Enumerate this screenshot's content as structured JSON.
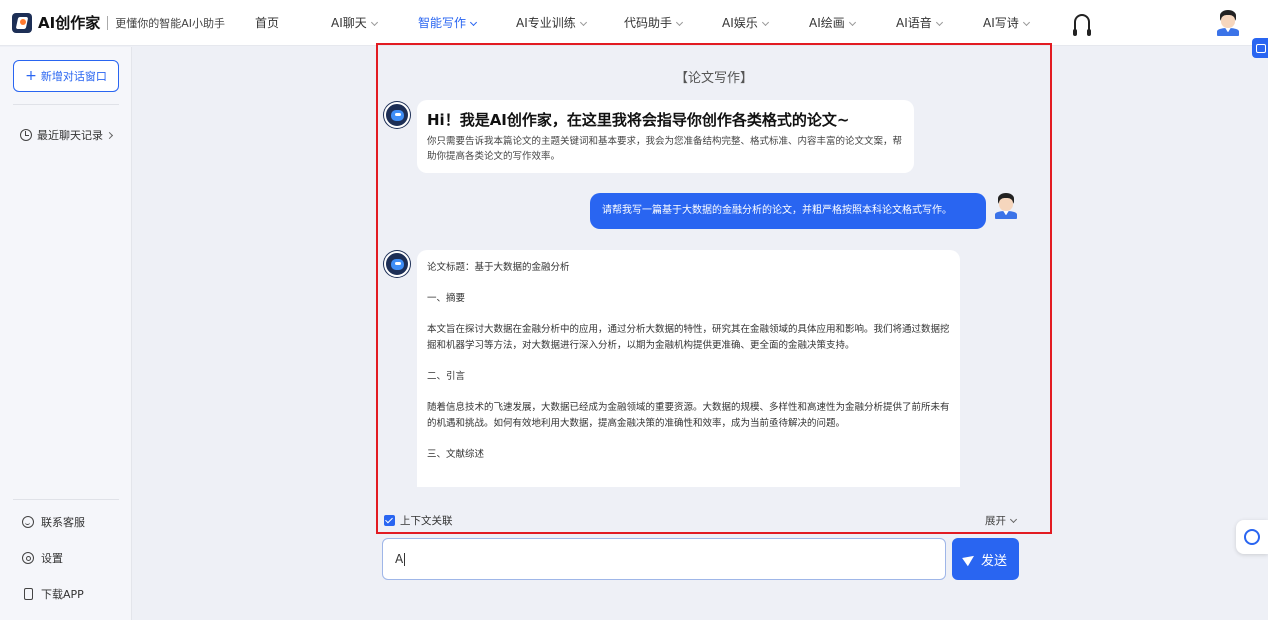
{
  "header": {
    "brand": "AI创作家",
    "tagline": "更懂你的智能AI小助手",
    "nav": [
      {
        "label": "首页",
        "dropdown": false
      },
      {
        "label": "AI聊天",
        "dropdown": true
      },
      {
        "label": "智能写作",
        "dropdown": true,
        "active": true
      },
      {
        "label": "AI专业训练",
        "dropdown": true
      },
      {
        "label": "代码助手",
        "dropdown": true
      },
      {
        "label": "AI娱乐",
        "dropdown": true
      },
      {
        "label": "AI绘画",
        "dropdown": true
      },
      {
        "label": "AI语音",
        "dropdown": true
      },
      {
        "label": "AI写诗",
        "dropdown": true
      }
    ],
    "icons": {
      "support": "headset-icon",
      "profile": "avatar"
    }
  },
  "sidebar": {
    "new_chat": "新增对话窗口",
    "recent": "最近聊天记录",
    "links": [
      {
        "label": "联系客服",
        "icon": "smile-icon"
      },
      {
        "label": "设置",
        "icon": "gear-icon"
      },
      {
        "label": "下载APP",
        "icon": "phone-icon"
      }
    ]
  },
  "chat": {
    "title": "【论文写作】",
    "greeting": {
      "title": "Hi！我是AI创作家，在这里我将会指导你创作各类格式的论文~",
      "description": "你只需要告诉我本篇论文的主题关键词和基本要求，我会为您准备结构完整、格式标准、内容丰富的论文文案，帮助你提高各类论文的写作效率。"
    },
    "user_message": "请帮我写一篇基于大数据的金融分析的论文，并粗严格按照本科论文格式写作。",
    "reply_paragraphs": [
      "论文标题：基于大数据的金融分析",
      "一、摘要",
      "本文旨在探讨大数据在金融分析中的应用，通过分析大数据的特性，研究其在金融领域的具体应用和影响。我们将通过数据挖掘和机器学习等方法，对大数据进行深入分析，以期为金融机构提供更准确、更全面的金融决策支持。",
      "二、引言",
      "随着信息技术的飞速发展，大数据已经成为金融领域的重要资源。大数据的规模、多样性和高速性为金融分析提供了前所未有的机遇和挑战。如何有效地利用大数据，提高金融决策的准确性和效率，成为当前亟待解决的问题。",
      "三、文献综述"
    ],
    "context_label": "上下文关联",
    "context_checked": true,
    "expand_label": "展开"
  },
  "input": {
    "value": "A",
    "send_label": "发送"
  },
  "colors": {
    "accent": "#2965f1",
    "highlight_border": "#e21b22"
  }
}
